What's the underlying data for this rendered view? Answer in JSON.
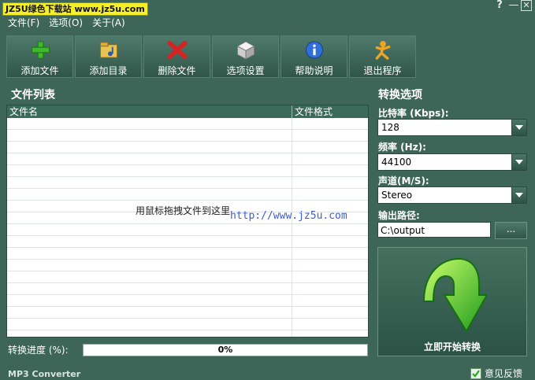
{
  "titlebar": {
    "badge": "JZ5U绿色下载站 www.jz5u.com",
    "help": "?",
    "minimize": "—",
    "close": "✕"
  },
  "menu": [
    "文件(F)",
    "选项(O)",
    "关于(A)"
  ],
  "toolbar": [
    {
      "label": "添加文件",
      "icon": "plus-icon"
    },
    {
      "label": "添加目录",
      "icon": "folder-music-icon"
    },
    {
      "label": "删除文件",
      "icon": "delete-x-icon"
    },
    {
      "label": "选项设置",
      "icon": "cube-icon"
    },
    {
      "label": "帮助说明",
      "icon": "info-icon"
    },
    {
      "label": "退出程序",
      "icon": "running-man-icon"
    }
  ],
  "file_list": {
    "title": "文件列表",
    "columns": [
      "文件名",
      "文件格式"
    ],
    "empty_hint": "用鼠标拖拽文件到这里",
    "watermark": "http://www.jz5u.com"
  },
  "progress": {
    "label": "转换进度 (%):",
    "value_text": "0%",
    "value": 0
  },
  "status": {
    "app_name": "MP3 Converter",
    "feedback": "意见反馈"
  },
  "options": {
    "title": "转换选项",
    "bitrate": {
      "label": "比特率 (Kbps):",
      "value": "128"
    },
    "frequency": {
      "label": "频率 (Hz):",
      "value": "44100"
    },
    "channel": {
      "label": "声道(M/S):",
      "value": "Stereo"
    },
    "output": {
      "label": "输出路径:",
      "value": "C:\\output",
      "browse": "..."
    },
    "start": "立即开始转换"
  },
  "colors": {
    "background": "#3d6658",
    "badge": "#f4ef2a",
    "progress_fill": "#39a84a",
    "watermark": "#3a5bd9"
  }
}
